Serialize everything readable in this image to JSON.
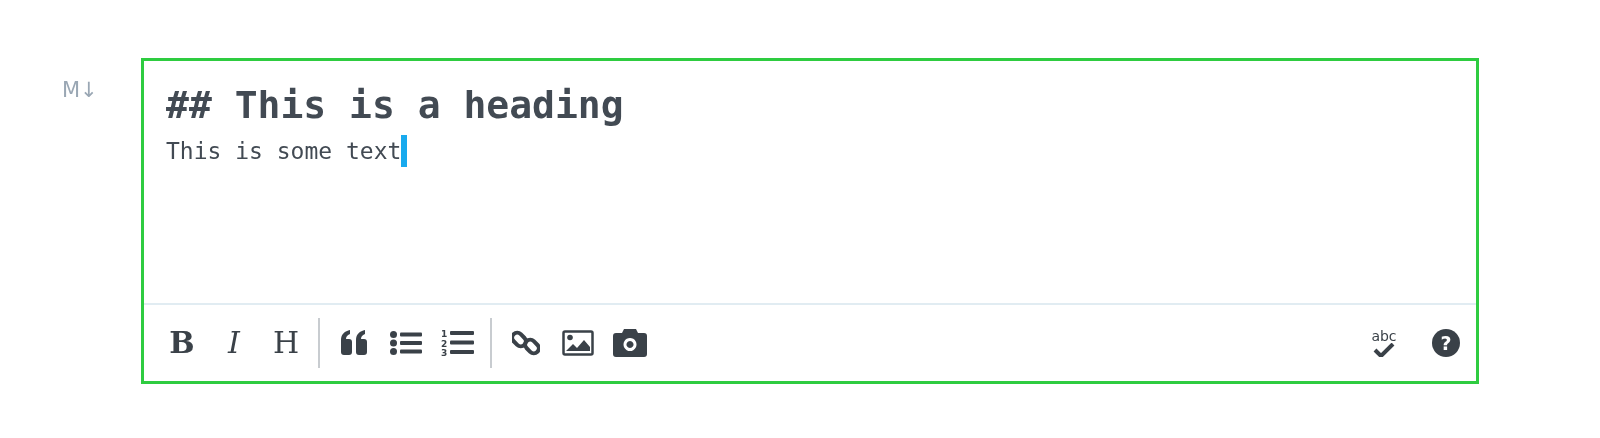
{
  "markdown_mark": "M↓",
  "editor": {
    "lines": [
      {
        "kind": "heading",
        "text": "## This is a heading"
      },
      {
        "kind": "body",
        "text": "This is some text",
        "cursor": true
      }
    ]
  },
  "toolbar": {
    "left": [
      [
        {
          "kind": "bold",
          "label": "B"
        },
        {
          "kind": "italic",
          "label": "I"
        },
        {
          "kind": "heading",
          "label": "H"
        }
      ],
      [
        {
          "kind": "quote"
        },
        {
          "kind": "bullet-list"
        },
        {
          "kind": "numbered-list",
          "numbers": [
            "1",
            "2",
            "3"
          ]
        }
      ],
      [
        {
          "kind": "link"
        },
        {
          "kind": "image"
        },
        {
          "kind": "camera"
        }
      ]
    ],
    "right": [
      {
        "kind": "spellcheck",
        "label": "abc",
        "on": true
      },
      {
        "kind": "help",
        "label": "?"
      }
    ]
  }
}
